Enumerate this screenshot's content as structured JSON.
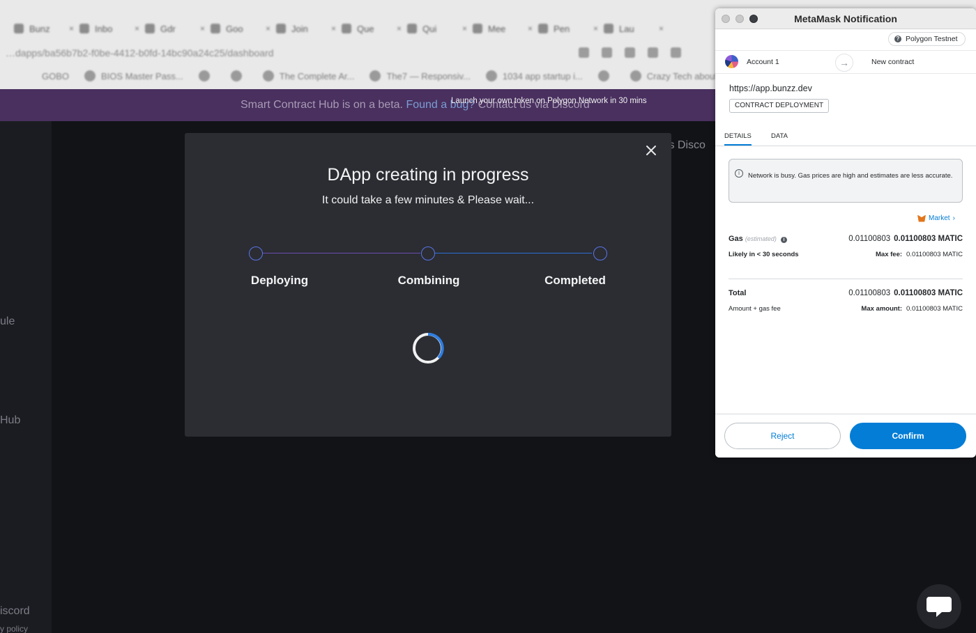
{
  "browser": {
    "tabs": [
      {
        "title": "Bunz"
      },
      {
        "title": "Inbo"
      },
      {
        "title": "Gdr"
      },
      {
        "title": "Goo"
      },
      {
        "title": "Join"
      },
      {
        "title": "Que"
      },
      {
        "title": "Qui"
      },
      {
        "title": "Mee"
      },
      {
        "title": "Pen"
      },
      {
        "title": "Lau"
      }
    ],
    "url": "…dapps/ba56b7b2-f0be-4412-b0fd-14bc90a24c25/dashboard",
    "bookmarks": [
      {
        "title": "GOBO"
      },
      {
        "title": "BIOS Master Pass..."
      },
      {
        "title": ""
      },
      {
        "title": ""
      },
      {
        "title": "The Complete Ar..."
      },
      {
        "title": "The7 — Responsiv..."
      },
      {
        "title": "1034 app startup i..."
      },
      {
        "title": ""
      },
      {
        "title": "Crazy Tech about..."
      }
    ]
  },
  "banner": {
    "text_before": "Smart Contract Hub is on a beta. ",
    "link_text": "Found a bug?",
    "text_after": " Contact us via Discord",
    "tooltip": "Launch your own token on Polygon Network in 30 mins"
  },
  "sidebar": {
    "items": [
      {
        "label": "ule"
      },
      {
        "label": "Hub"
      },
      {
        "label": "iscord"
      },
      {
        "label": "y policy"
      }
    ]
  },
  "page": {
    "nav_partial": "ts  Disco"
  },
  "modal": {
    "title": "DApp creating in progress",
    "subtitle": "It could take a few minutes & Please wait...",
    "steps": [
      {
        "label": "Deploying"
      },
      {
        "label": "Combining"
      },
      {
        "label": "Completed"
      }
    ],
    "colors": {
      "step_border": "#5a74e8",
      "line_done": "#6b4fb0",
      "line_active": "#2e6fd6",
      "spinner": "#2f7de1"
    }
  },
  "metamask": {
    "window_title": "MetaMask Notification",
    "network": "Polygon Testnet",
    "account": "Account 1",
    "recipient": "New contract",
    "origin": "https://app.bunzz.dev",
    "tx_type": "CONTRACT DEPLOYMENT",
    "tabs": [
      {
        "label": "DETAILS"
      },
      {
        "label": "DATA"
      }
    ],
    "warning": "Network is busy. Gas prices are high and estimates are less accurate.",
    "market_label": "Market",
    "gas": {
      "label": "Gas",
      "estimated_tag": "(estimated)",
      "fiat": "0.01100803",
      "amount": "0.01100803 MATIC",
      "likely": "Likely in < 30 seconds",
      "max_fee_label": "Max fee:",
      "max_fee": "0.01100803 MATIC"
    },
    "total": {
      "label": "Total",
      "fiat": "0.01100803",
      "amount": "0.01100803 MATIC",
      "sub": "Amount + gas fee",
      "max_amount_label": "Max amount:",
      "max_amount": "0.01100803 MATIC"
    },
    "reject_label": "Reject",
    "confirm_label": "Confirm",
    "colors": {
      "accent": "#037dd6"
    }
  }
}
